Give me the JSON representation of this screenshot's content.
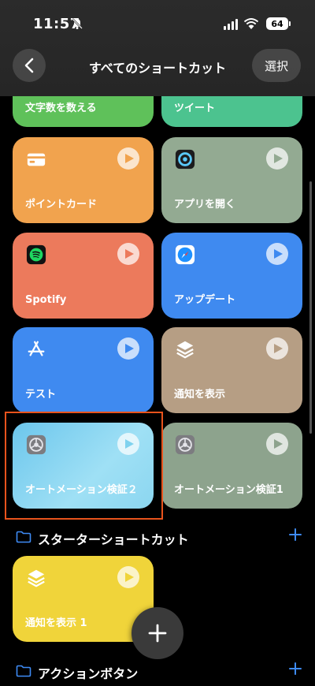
{
  "status_bar": {
    "time": "11:57",
    "battery": "64"
  },
  "nav": {
    "title": "すべてのショートカット",
    "select_label": "選択"
  },
  "cards": [
    {
      "label": "文字数を数える",
      "color": "#5fc15a"
    },
    {
      "label": "ツイート",
      "color": "#4cc38f"
    },
    {
      "label": "ポイントカード",
      "color": "#f1a34e",
      "icon": "card-icon"
    },
    {
      "label": "アプリを開く",
      "color": "#93aa92",
      "icon": "app-open-icon"
    },
    {
      "label": "Spotify",
      "color": "#ec7a5c",
      "icon": "spotify-icon"
    },
    {
      "label": "アップデート",
      "color": "#3f8af0",
      "icon": "safari-icon"
    },
    {
      "label": "テスト",
      "color": "#3f8af0",
      "icon": "app-store-icon"
    },
    {
      "label": "通知を表示",
      "color": "#b69e84",
      "icon": "layers-icon"
    },
    {
      "label": "オートメーション検証２",
      "color": "#7fd2ee",
      "icon": "settings-icon"
    },
    {
      "label": "オートメーション検証1",
      "color": "#8da38d",
      "icon": "settings-icon"
    },
    {
      "label": "通知を表示 1",
      "color": "#f0d43a",
      "icon": "layers-icon"
    }
  ],
  "sections": [
    {
      "title": "スターターショートカット"
    },
    {
      "title": "アクションボタン"
    }
  ],
  "colors": {
    "accent": "#3e8bf5",
    "highlight": "#e8531c"
  }
}
